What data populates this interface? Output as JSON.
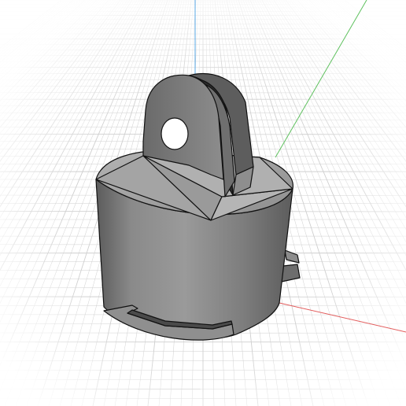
{
  "viewport": {
    "background_color": "#ffffff",
    "grid_color": "#cfcfcf",
    "axes": {
      "x_color": "#e25c5c",
      "y_color": "#5fc15f",
      "z_color": "#5aa8e6"
    }
  },
  "model": {
    "name": "",
    "body_color": "#7a7a7a",
    "edge_color": "#111111",
    "highlight_color": "#a9a9a9",
    "shadow_color": "#3f3f3f"
  }
}
